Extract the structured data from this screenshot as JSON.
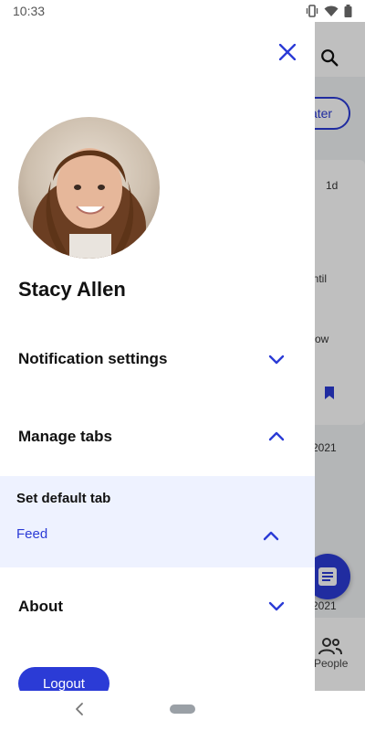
{
  "status_bar": {
    "time": "10:33"
  },
  "drawer": {
    "user_name": "Stacy Allen",
    "menu": {
      "notification_settings": "Notification settings",
      "manage_tabs": "Manage tabs",
      "set_default_tab_label": "Set default tab",
      "set_default_tab_value": "Feed",
      "about": "About",
      "logout": "Logout"
    }
  },
  "background": {
    "later_button": "ater",
    "card_time": "1d",
    "card_text_1": "until",
    "card_text_2": "ow",
    "date_1": "2021",
    "date_2": "2021",
    "nav_people": "People"
  },
  "colors": {
    "accent": "#2b3bd6",
    "subpanel_bg": "#eef2ff"
  },
  "icons": [
    "close-icon",
    "chevron-down-icon",
    "chevron-up-icon",
    "search-icon",
    "bookmark-icon",
    "chat-icon",
    "people-icon",
    "back-icon",
    "home-icon"
  ]
}
